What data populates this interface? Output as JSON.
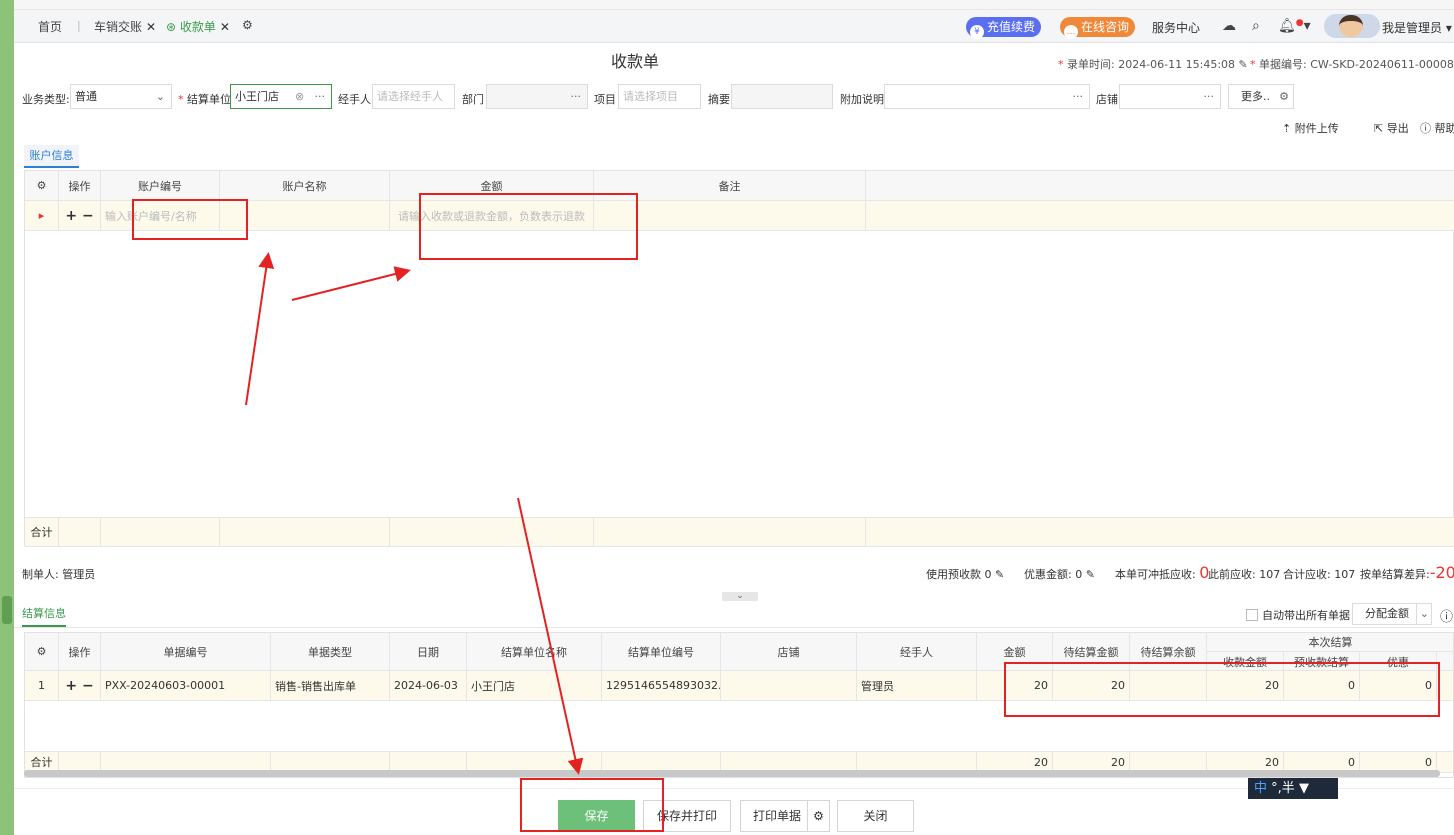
{
  "tabs": {
    "home": "首页",
    "t1": "车销交账",
    "t2": "收款单"
  },
  "header": {
    "recharge": "充值续费",
    "consult": "在线咨询",
    "service": "服务中心",
    "user": "我是管理员"
  },
  "page": {
    "title": "收款单",
    "time_label": "录单时间:",
    "time_value": "2024-06-11 15:45:08",
    "no_label": "单据编号:",
    "no_value": "CW-SKD-20240611-00008"
  },
  "form": {
    "biz_type_label": "业务类型:",
    "biz_type_value": "普通",
    "unit_label": "结算单位",
    "unit_value": "小王门店",
    "handler_label": "经手人",
    "handler_ph": "请选择经手人",
    "dept_label": "部门",
    "project_label": "项目",
    "project_ph": "请选择项目",
    "summary_label": "摘要",
    "extra_label": "附加说明",
    "store_label": "店铺",
    "more_label": "更多.."
  },
  "toolbar": {
    "upload": "附件上传",
    "export": "导出",
    "help": "帮助"
  },
  "account_tab": "账户信息",
  "account_grid": {
    "headers": [
      "操作",
      "账户编号",
      "账户名称",
      "金额",
      "备注"
    ],
    "row_ph_account": "输入账户编号/名称",
    "row_ph_amount": "请输入收款或退款金额，负数表示退款",
    "total_label": "合计"
  },
  "status": {
    "creator": "制单人: 管理员",
    "prepaid": "使用预收款 0",
    "discount": "优惠金额: 0",
    "offset_label": "本单可冲抵应收:",
    "offset_value": "0",
    "prev": "此前应收: 107",
    "total": "合计应收: 107",
    "diff_label": "按单结算差异:",
    "diff_value": "-20"
  },
  "settle_tab": "结算信息",
  "settle_tools": {
    "auto": "自动带出所有单据",
    "alloc": "分配金额"
  },
  "settle_grid": {
    "headers": [
      "操作",
      "单据编号",
      "单据类型",
      "日期",
      "结算单位名称",
      "结算单位编号",
      "店铺",
      "经手人",
      "金额",
      "待结算金额",
      "待结算余额"
    ],
    "group_header": "本次结算",
    "sub_headers": [
      "收款金额",
      "预收款结算",
      "优惠"
    ],
    "row": {
      "idx": "1",
      "no": "PXX-20240603-00001",
      "type": "销售-销售出库单",
      "date": "2024-06-03",
      "unit_name": "小王门店",
      "unit_no": "1295146554893032...",
      "store": "",
      "handler": "管理员",
      "amount": "20",
      "pending": "20",
      "pending_bal": "",
      "receive": "20",
      "prepay": "0",
      "discount": "0"
    },
    "total": {
      "label": "合计",
      "amount": "20",
      "pending": "20",
      "receive": "20",
      "prepay": "0",
      "discount": "0"
    }
  },
  "buttons": {
    "save": "保存",
    "save_print": "保存并打印",
    "print": "打印单据",
    "close": "关闭"
  },
  "ime": {
    "zh": "中",
    "rest": "°,半"
  }
}
